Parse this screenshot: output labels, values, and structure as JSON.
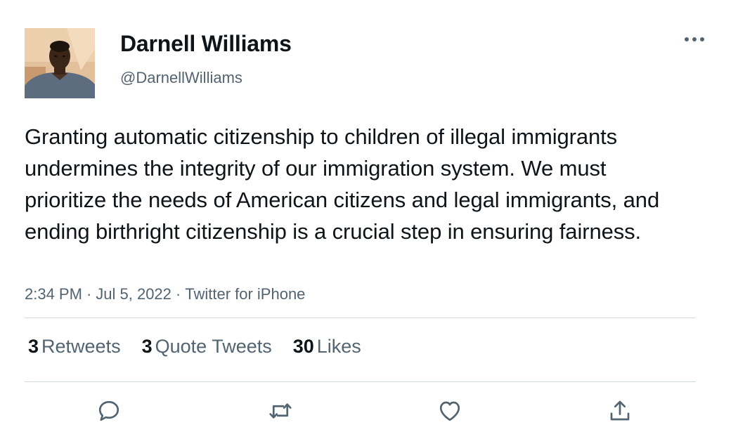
{
  "tweet": {
    "author": {
      "name": "Darnell Williams",
      "handle": "@DarnellWilliams"
    },
    "text": "Granting automatic citizenship to children of illegal immigrants undermines the integrity of our immigration system. We must prioritize the needs of American citizens and legal immigrants, and ending birthright citizenship is a crucial step in ensuring fairness.",
    "time": "2:34 PM",
    "date": "Jul 5, 2022",
    "source": "Twitter for iPhone",
    "separator": "·",
    "stats": {
      "retweets": {
        "count": "3",
        "label": "Retweets"
      },
      "quotes": {
        "count": "3",
        "label": "Quote Tweets"
      },
      "likes": {
        "count": "30",
        "label": "Likes"
      }
    },
    "actions": [
      "reply-icon",
      "retweet-icon",
      "like-icon",
      "share-icon"
    ],
    "more_icon": "more-icon"
  },
  "colors": {
    "text_primary": "#0f1419",
    "text_secondary": "#536471",
    "divider": "#cfd9de",
    "icon": "#536471"
  }
}
